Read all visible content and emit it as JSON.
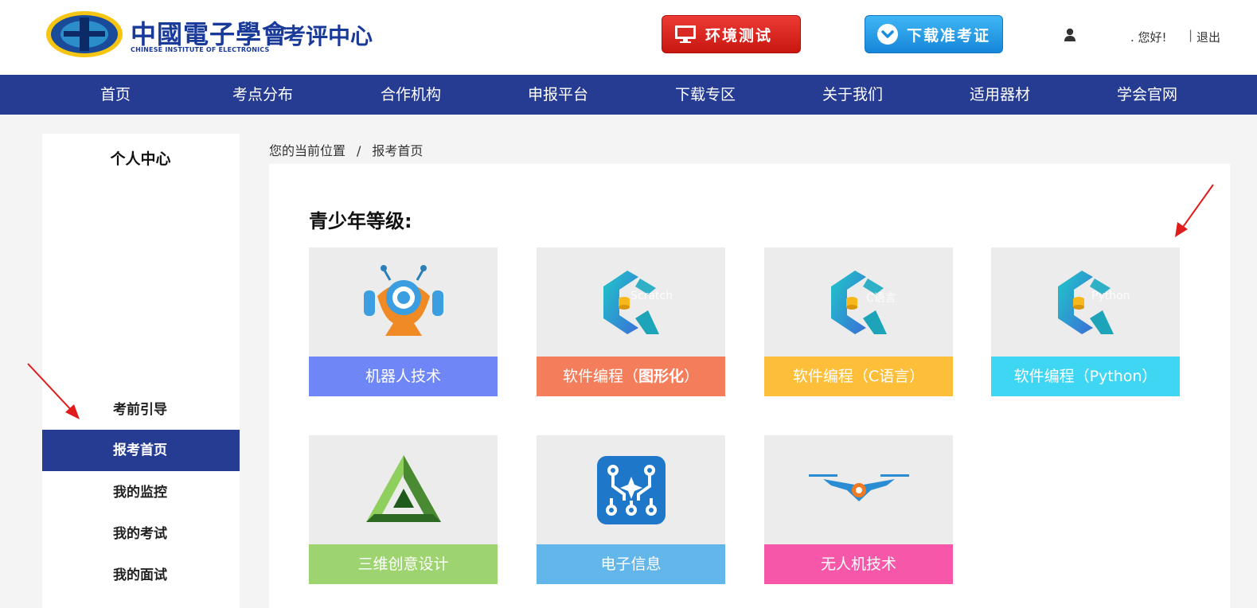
{
  "header": {
    "logo_text": "中國電子學會",
    "logo_sub": "CHINESE INSTITUTE OF ELECTRONICS",
    "center_name": "考评中心",
    "env_test_label": "环境测试",
    "download_ticket_label": "下载准考证",
    "greeting": ". 您好!",
    "separator": "|",
    "logout_label": "退出"
  },
  "nav": {
    "items": [
      "首页",
      "考点分布",
      "合作机构",
      "申报平台",
      "下载专区",
      "关于我们",
      "适用器材",
      "学会官网"
    ]
  },
  "sidebar": {
    "title": "个人中心",
    "items": [
      "考前引导",
      "报考首页",
      "我的监控",
      "我的考试",
      "我的面试"
    ],
    "active_index": 1
  },
  "breadcrumb": {
    "prefix": "您的当前位置",
    "separator": "/",
    "current": "报考首页"
  },
  "main": {
    "section_title": "青少年等级:",
    "cards": [
      {
        "label": "机器人技术",
        "color": "#6f86f7",
        "icon": "robot-icon"
      },
      {
        "label_prefix": "软件编程（",
        "label_bold": "图形化",
        "label_suffix": "）",
        "overlay": "Scratch",
        "color": "#f47e5b",
        "icon": "programming-c-logo-icon"
      },
      {
        "label": "软件编程（C语言）",
        "overlay": "C语言",
        "color": "#fdbf3a",
        "icon": "programming-c-logo-icon"
      },
      {
        "label": "软件编程（Python）",
        "overlay": "Python",
        "color": "#3fd6f4",
        "icon": "programming-c-logo-icon"
      },
      {
        "label": "三维创意设计",
        "color": "#9ed46f",
        "icon": "triangle-3d-icon"
      },
      {
        "label": "电子信息",
        "color": "#63b6ea",
        "icon": "circuit-board-icon"
      },
      {
        "label": "无人机技术",
        "color": "#f757a8",
        "icon": "drone-icon"
      }
    ]
  },
  "colors": {
    "nav_bg": "#263c92",
    "env_btn": "#d92a23",
    "download_btn": "#2a9de8",
    "annotation_arrow": "#e01b1b"
  }
}
